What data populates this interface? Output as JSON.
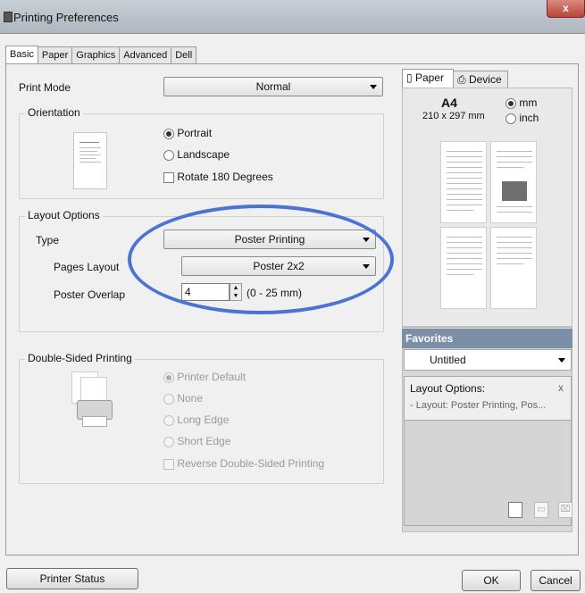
{
  "window": {
    "title": "Printing Preferences",
    "close_label": "x"
  },
  "tabs": [
    "Basic",
    "Paper",
    "Graphics",
    "Advanced",
    "Dell"
  ],
  "print_mode": {
    "label": "Print Mode",
    "value": "Normal"
  },
  "orientation": {
    "title": "Orientation",
    "portrait": "Portrait",
    "landscape": "Landscape",
    "rotate": "Rotate 180 Degrees"
  },
  "layout": {
    "title": "Layout Options",
    "type_label": "Type",
    "type_value": "Poster Printing",
    "pages_label": "Pages Layout",
    "pages_value": "Poster 2x2",
    "overlap_label": "Poster Overlap",
    "overlap_value": "4",
    "overlap_range": "(0 - 25 mm)"
  },
  "duplex": {
    "title": "Double-Sided Printing",
    "printer_default": "Printer Default",
    "none": "None",
    "long_edge": "Long Edge",
    "short_edge": "Short Edge",
    "reverse": "Reverse Double-Sided Printing"
  },
  "right": {
    "tab_paper": "Paper",
    "tab_device": "Device",
    "paper_size": "A4",
    "paper_dims": "210 x 297 mm",
    "unit_mm": "mm",
    "unit_inch": "inch"
  },
  "favorites": {
    "header": "Favorites",
    "selected": "Untitled",
    "info_title": "Layout Options:",
    "info_close": "x",
    "info_line": "- Layout: Poster Printing, Pos..."
  },
  "buttons": {
    "printer_status": "Printer Status",
    "ok": "OK",
    "cancel": "Cancel"
  },
  "colors": {
    "annotation": "#4a73d4",
    "favorites_header": "#7b8fa6"
  }
}
